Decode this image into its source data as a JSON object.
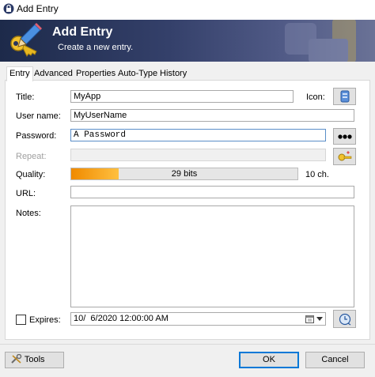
{
  "window": {
    "title": "Add Entry"
  },
  "banner": {
    "title": "Add Entry",
    "subtitle": "Create a new entry."
  },
  "tabs": [
    {
      "label": "Entry",
      "active": true
    },
    {
      "label": "Advanced",
      "active": false
    },
    {
      "label": "Properties",
      "active": false
    },
    {
      "label": "Auto-Type",
      "active": false
    },
    {
      "label": "History",
      "active": false
    }
  ],
  "form": {
    "title_label": "Title:",
    "title_value": "MyApp",
    "icon_label": "Icon:",
    "username_label": "User name:",
    "username_value": "MyUserName",
    "password_label": "Password:",
    "password_value": "A Password",
    "repeat_label": "Repeat:",
    "repeat_value": "",
    "quality_label": "Quality:",
    "quality_bits": "29 bits",
    "quality_fraction": 0.21,
    "quality_chars": "10 ch.",
    "url_label": "URL:",
    "url_value": "",
    "notes_label": "Notes:",
    "notes_value": "",
    "expires_label": "Expires:",
    "expires_checked": false,
    "expires_value": "10/  6/2020 12:00:00 AM"
  },
  "footer": {
    "tools_label": "Tools",
    "ok_label": "OK",
    "cancel_label": "Cancel"
  },
  "colors": {
    "accent": "#0078d7",
    "quality_fill": "#f08a00",
    "banner_dark": "#1d2a4a"
  },
  "icons": {
    "app": "keepass-lock-icon",
    "banner": "key-pencil-icon",
    "entry_icon": "standard-key-icon",
    "show_password": "dots-icon",
    "generator": "key-generator-icon",
    "calendar": "calendar-icon",
    "expiry_preset": "clock-icon",
    "tools": "wrench-icon"
  }
}
